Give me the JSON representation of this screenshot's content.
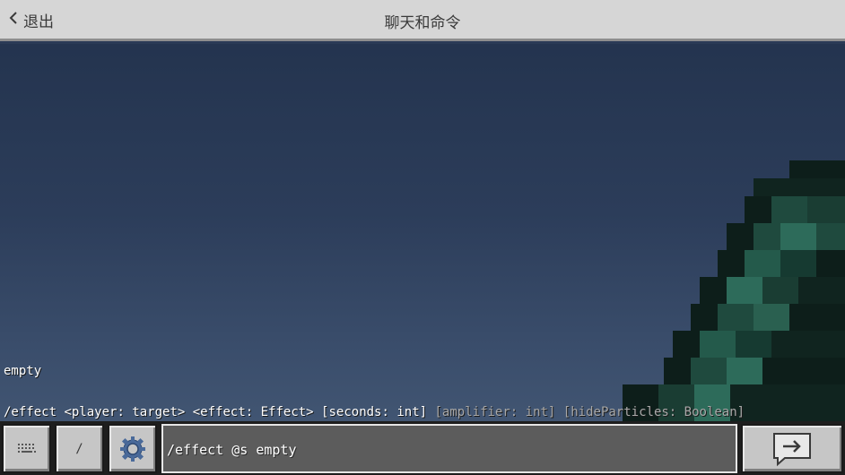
{
  "header": {
    "back_label": "退出",
    "title": "聊天和命令"
  },
  "chat": {
    "message": "empty",
    "hint": {
      "command": "/effect",
      "player_param": "<player: target>",
      "effect_param": "<effect: Effect>",
      "seconds_param": "[seconds: int]",
      "amplifier_param": "[amplifier: int]",
      "hide_particles_param": "[hideParticles: Boolean]"
    }
  },
  "bottombar": {
    "slash_label": "/",
    "input_value": "/effect @s empty"
  },
  "icons": {
    "back": "chevron-left-icon",
    "keyboard": "keyboard-icon",
    "settings": "gear-icon",
    "send": "send-arrow-icon"
  }
}
